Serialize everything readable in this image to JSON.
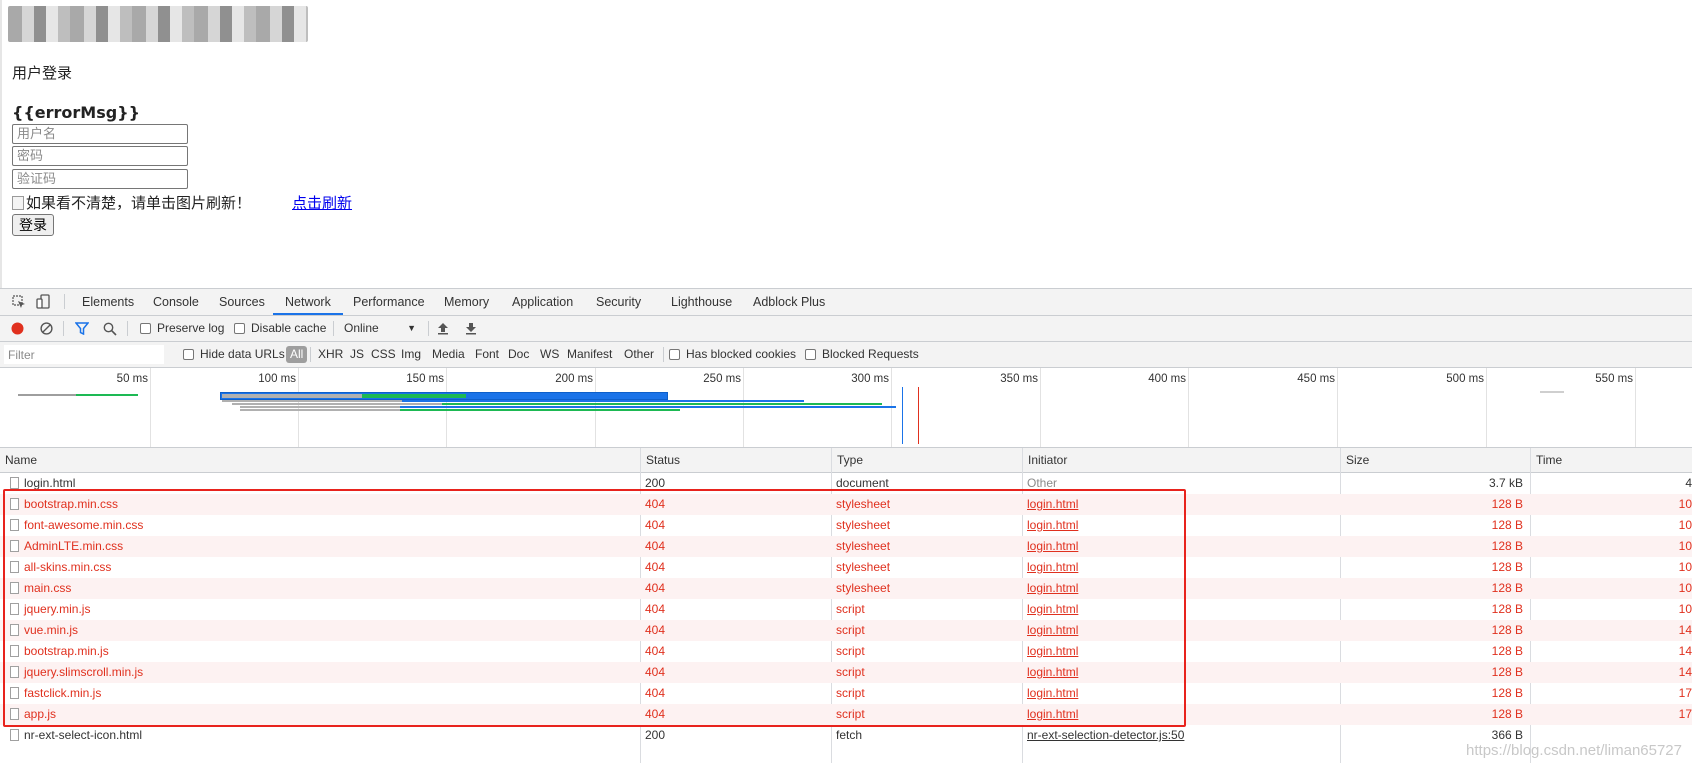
{
  "page": {
    "title": "用户登录",
    "error_msg": "{{errorMsg}}",
    "username_placeholder": "用户名",
    "password_placeholder": "密码",
    "captcha_placeholder": "验证码",
    "captcha_img_alt": "如果看不清楚，请单击图片刷新！",
    "refresh_link": "点击刷新",
    "login_button": "登录"
  },
  "devtools": {
    "tabs": [
      "Elements",
      "Console",
      "Sources",
      "Network",
      "Performance",
      "Memory",
      "Application",
      "Security",
      "Lighthouse",
      "Adblock Plus"
    ],
    "active_tab": "Network",
    "toolbar": {
      "preserve_log": "Preserve log",
      "disable_cache": "Disable cache",
      "throttle": "Online"
    },
    "filter": {
      "placeholder": "Filter",
      "hide_data_urls": "Hide data URLs",
      "types": [
        "All",
        "XHR",
        "JS",
        "CSS",
        "Img",
        "Media",
        "Font",
        "Doc",
        "WS",
        "Manifest",
        "Other"
      ],
      "has_blocked_cookies": "Has blocked cookies",
      "blocked_requests": "Blocked Requests"
    },
    "overview_ticks": [
      "50 ms",
      "100 ms",
      "150 ms",
      "200 ms",
      "250 ms",
      "300 ms",
      "350 ms",
      "400 ms",
      "450 ms",
      "500 ms",
      "550 ms"
    ],
    "columns": [
      "Name",
      "Status",
      "Type",
      "Initiator",
      "Size",
      "Time"
    ],
    "rows": [
      {
        "name": "login.html",
        "status": "200",
        "type": "document",
        "initiator": "Other",
        "size": "3.7 kB",
        "time": "4",
        "error": false
      },
      {
        "name": "bootstrap.min.css",
        "status": "404",
        "type": "stylesheet",
        "initiator": "login.html",
        "size": "128 B",
        "time": "10",
        "error": true
      },
      {
        "name": "font-awesome.min.css",
        "status": "404",
        "type": "stylesheet",
        "initiator": "login.html",
        "size": "128 B",
        "time": "10",
        "error": true
      },
      {
        "name": "AdminLTE.min.css",
        "status": "404",
        "type": "stylesheet",
        "initiator": "login.html",
        "size": "128 B",
        "time": "10",
        "error": true
      },
      {
        "name": "all-skins.min.css",
        "status": "404",
        "type": "stylesheet",
        "initiator": "login.html",
        "size": "128 B",
        "time": "10",
        "error": true
      },
      {
        "name": "main.css",
        "status": "404",
        "type": "stylesheet",
        "initiator": "login.html",
        "size": "128 B",
        "time": "10",
        "error": true
      },
      {
        "name": "jquery.min.js",
        "status": "404",
        "type": "script",
        "initiator": "login.html",
        "size": "128 B",
        "time": "10",
        "error": true
      },
      {
        "name": "vue.min.js",
        "status": "404",
        "type": "script",
        "initiator": "login.html",
        "size": "128 B",
        "time": "14",
        "error": true
      },
      {
        "name": "bootstrap.min.js",
        "status": "404",
        "type": "script",
        "initiator": "login.html",
        "size": "128 B",
        "time": "14",
        "error": true
      },
      {
        "name": "jquery.slimscroll.min.js",
        "status": "404",
        "type": "script",
        "initiator": "login.html",
        "size": "128 B",
        "time": "14",
        "error": true
      },
      {
        "name": "fastclick.min.js",
        "status": "404",
        "type": "script",
        "initiator": "login.html",
        "size": "128 B",
        "time": "17",
        "error": true
      },
      {
        "name": "app.js",
        "status": "404",
        "type": "script",
        "initiator": "login.html",
        "size": "128 B",
        "time": "17",
        "error": true
      },
      {
        "name": "nr-ext-select-icon.html",
        "status": "200",
        "type": "fetch",
        "initiator": "nr-ext-selection-detector.js:50",
        "size": "366 B",
        "time": "",
        "error": false
      }
    ],
    "watermark": "https://blog.csdn.net/liman65727",
    "colors": {
      "error_red": "#e0301e",
      "accent_blue": "#1a73e8",
      "highlight_box": "#e8231d"
    }
  }
}
